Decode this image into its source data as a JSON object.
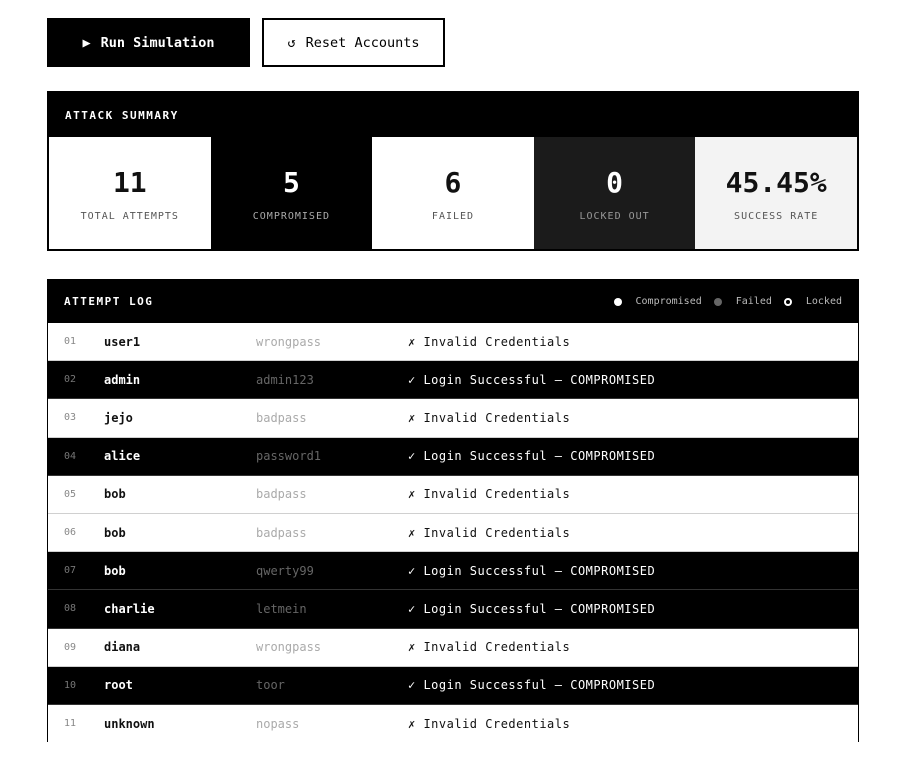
{
  "actions": {
    "run_label": "Run Simulation",
    "run_icon": "▶",
    "reset_label": "Reset Accounts",
    "reset_icon": "↺"
  },
  "summary": {
    "title": "ATTACK SUMMARY",
    "stats": [
      {
        "value": "11",
        "label": "TOTAL ATTEMPTS"
      },
      {
        "value": "5",
        "label": "COMPROMISED"
      },
      {
        "value": "6",
        "label": "FAILED"
      },
      {
        "value": "0",
        "label": "LOCKED OUT"
      },
      {
        "value": "45.45%",
        "label": "SUCCESS RATE"
      }
    ]
  },
  "log": {
    "title": "ATTEMPT LOG",
    "legend": {
      "compromised": "Compromised",
      "failed": "Failed",
      "locked": "Locked"
    },
    "rows": [
      {
        "index": "01",
        "user": "user1",
        "password": "wrongpass",
        "result": "✗ Invalid Credentials",
        "status": "failed"
      },
      {
        "index": "02",
        "user": "admin",
        "password": "admin123",
        "result": "✓ Login Successful — COMPROMISED",
        "status": "compromised"
      },
      {
        "index": "03",
        "user": "jejo",
        "password": "badpass",
        "result": "✗ Invalid Credentials",
        "status": "failed"
      },
      {
        "index": "04",
        "user": "alice",
        "password": "password1",
        "result": "✓ Login Successful — COMPROMISED",
        "status": "compromised"
      },
      {
        "index": "05",
        "user": "bob",
        "password": "badpass",
        "result": "✗ Invalid Credentials",
        "status": "failed"
      },
      {
        "index": "06",
        "user": "bob",
        "password": "badpass",
        "result": "✗ Invalid Credentials",
        "status": "failed"
      },
      {
        "index": "07",
        "user": "bob",
        "password": "qwerty99",
        "result": "✓ Login Successful — COMPROMISED",
        "status": "compromised"
      },
      {
        "index": "08",
        "user": "charlie",
        "password": "letmein",
        "result": "✓ Login Successful — COMPROMISED",
        "status": "compromised"
      },
      {
        "index": "09",
        "user": "diana",
        "password": "wrongpass",
        "result": "✗ Invalid Credentials",
        "status": "failed"
      },
      {
        "index": "10",
        "user": "root",
        "password": "toor",
        "result": "✓ Login Successful — COMPROMISED",
        "status": "compromised"
      },
      {
        "index": "11",
        "user": "unknown",
        "password": "nopass",
        "result": "✗ Invalid Credentials",
        "status": "failed"
      }
    ]
  }
}
